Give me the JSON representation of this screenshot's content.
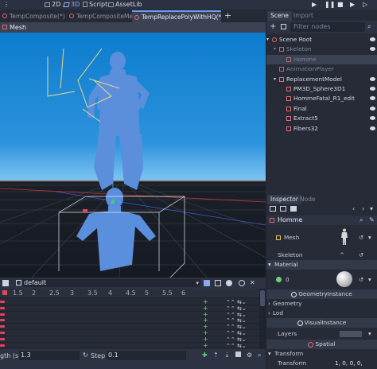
{
  "topbar": {
    "modes": [
      {
        "label": "2D",
        "icon": "2d-icon",
        "active": false
      },
      {
        "label": "3D",
        "icon": "3d-icon",
        "active": true
      },
      {
        "label": "Script",
        "icon": "script-icon",
        "active": false
      },
      {
        "label": "AssetLib",
        "icon": "assetlib-icon",
        "active": false
      }
    ]
  },
  "tabs": [
    {
      "label": "TempComposite(*)",
      "active": false
    },
    {
      "label": "TempCompositeMesh",
      "active": false
    },
    {
      "label": "TempReplacePolyWithHQ(*)",
      "active": true
    }
  ],
  "viewport": {
    "header_label": "Mesh"
  },
  "scene_dock": {
    "tabs": [
      "Scene",
      "Import"
    ],
    "filter_placeholder": "Filter nodes",
    "nodes": [
      {
        "label": "Scene Root",
        "depth": 0,
        "dim": false,
        "selected": false,
        "eye": true
      },
      {
        "label": "Skeleton",
        "depth": 1,
        "dim": true,
        "selected": false,
        "eye": true
      },
      {
        "label": "Homme",
        "depth": 2,
        "dim": true,
        "selected": true,
        "eye": false
      },
      {
        "label": "AnimationPlayer",
        "depth": 1,
        "dim": true,
        "selected": false,
        "eye": false
      },
      {
        "label": "ReplacementModel",
        "depth": 1,
        "dim": false,
        "selected": false,
        "eye": true
      },
      {
        "label": "PM3D_Sphere3D1",
        "depth": 2,
        "dim": false,
        "selected": false,
        "eye": true
      },
      {
        "label": "HommeFatal_R1_edit",
        "depth": 2,
        "dim": false,
        "selected": false,
        "eye": true
      },
      {
        "label": "Final",
        "depth": 2,
        "dim": false,
        "selected": false,
        "eye": true
      },
      {
        "label": "Extract5",
        "depth": 2,
        "dim": false,
        "selected": false,
        "eye": true
      },
      {
        "label": "Fibers32",
        "depth": 2,
        "dim": false,
        "selected": false,
        "eye": true
      }
    ]
  },
  "inspector": {
    "tabs": [
      "Inspector",
      "Node"
    ],
    "object_name": "Homme",
    "props": {
      "mesh_label": "Mesh",
      "skeleton_label": "Skeleton",
      "material_section": "Material",
      "material_index": "0",
      "geometry_instance": "GeometryInstance",
      "geometry": "Geometry",
      "lod": "Lod",
      "visual_instance": "VisualInstance",
      "layers": "Layers",
      "spatial": "Spatial",
      "transform_section": "Transform",
      "transform_label": "Transform",
      "transform_value": "1, 0, 0, 0,"
    }
  },
  "animation": {
    "animation_name": "default",
    "ruler": [
      "1.5",
      "2",
      "2.5",
      "3",
      "3.5",
      "4",
      "4.5",
      "5",
      "5.5",
      "6"
    ],
    "track_count": 8,
    "length_label": "gth (s):",
    "length_value": "1.3",
    "step_label": "Step (s):",
    "step_value": "0.1"
  },
  "colors": {
    "accent": "#6f9bef",
    "sky_top": "#0d7ccd",
    "ground": "#161a22",
    "model": "#4f86d8",
    "key_red": "#e7445a",
    "add_green": "#6ad27a"
  }
}
